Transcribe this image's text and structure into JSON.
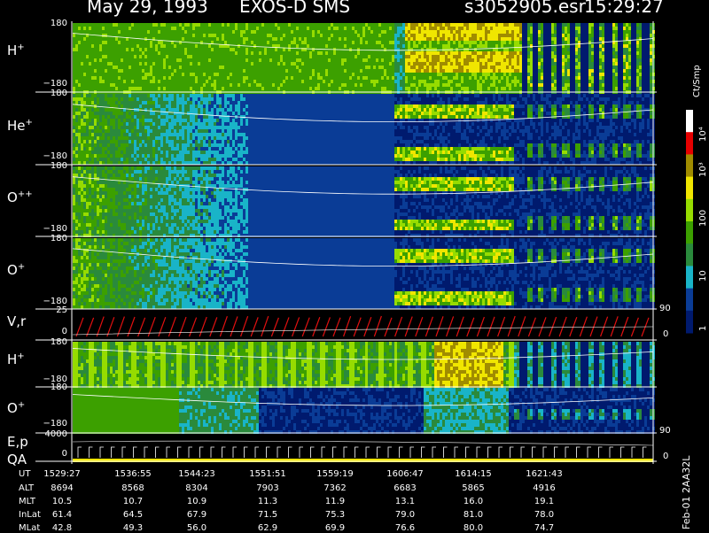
{
  "header": {
    "date": "May 29, 1993",
    "mission": "EXOS-D SMS",
    "file": "s3052905.esr",
    "time": "15:29:27"
  },
  "panels": [
    {
      "label": "H",
      "charge": "+",
      "top": "180",
      "bottom": "−180"
    },
    {
      "label": "He",
      "charge": "+",
      "top": "180",
      "bottom": "−180"
    },
    {
      "label": "O",
      "charge": "++",
      "top": "180",
      "bottom": "−180"
    },
    {
      "label": "O",
      "charge": "+",
      "top": "180",
      "bottom": "−180"
    },
    {
      "label": "V,r",
      "charge": "",
      "top": "25",
      "bottom": "0"
    },
    {
      "label": "H",
      "charge": "+",
      "top": "180",
      "bottom": "−180"
    },
    {
      "label": "O",
      "charge": "+",
      "top": "180",
      "bottom": "−180"
    },
    {
      "label": "E,p",
      "charge": "",
      "top": "4000",
      "bottom": "0"
    }
  ],
  "qa_label": "QA",
  "right_ticks": {
    "vr_top": "90",
    "vr_bottom": "0",
    "ep_top": "90",
    "ep_bottom": "0"
  },
  "colorbar": {
    "unit": "Ct/Smp",
    "labels": [
      "10⁴",
      "10³",
      "100",
      "10",
      "1"
    ]
  },
  "table": {
    "rows": [
      {
        "label": "UT",
        "values": [
          "1529:27",
          "1536:55",
          "1544:23",
          "1551:51",
          "1559:19",
          "1606:47",
          "1614:15",
          "1621:43"
        ]
      },
      {
        "label": "ALT",
        "values": [
          "8694",
          "8568",
          "8304",
          "7903",
          "7362",
          "6683",
          "5865",
          "4916"
        ]
      },
      {
        "label": "MLT",
        "values": [
          "10.5",
          "10.7",
          "10.9",
          "11.3",
          "11.9",
          "13.1",
          "16.0",
          "19.1"
        ]
      },
      {
        "label": "InLat",
        "values": [
          "61.4",
          "64.5",
          "67.9",
          "71.5",
          "75.3",
          "79.0",
          "81.0",
          "78.0"
        ]
      },
      {
        "label": "MLat",
        "values": [
          "42.8",
          "49.3",
          "56.0",
          "62.9",
          "69.9",
          "76.6",
          "80.0",
          "74.7"
        ]
      }
    ]
  },
  "footer_tag": "Feb-01 2AA32L",
  "chart_data": {
    "type": "heatmap",
    "title": "May 29, 1993   EXOS-D SMS",
    "x_ticks": [
      "1529:27",
      "1536:55",
      "1544:23",
      "1551:51",
      "1559:19",
      "1606:47",
      "1614:15",
      "1621:43"
    ],
    "panels": [
      {
        "name": "H+",
        "ylim": [
          -180,
          180
        ]
      },
      {
        "name": "He+",
        "ylim": [
          -180,
          180
        ]
      },
      {
        "name": "O++",
        "ylim": [
          -180,
          180
        ]
      },
      {
        "name": "O+",
        "ylim": [
          -180,
          180
        ]
      },
      {
        "name": "V,r",
        "ylim": [
          0,
          25
        ],
        "right_ylim": [
          0,
          90
        ]
      },
      {
        "name": "H+",
        "ylim": [
          -180,
          180
        ]
      },
      {
        "name": "O+",
        "ylim": [
          -180,
          180
        ]
      },
      {
        "name": "E,p",
        "ylim": [
          0,
          4000
        ],
        "right_ylim": [
          0,
          90
        ]
      }
    ],
    "colorbar": {
      "label": "Ct/Smp",
      "scale": "log",
      "range": [
        1,
        10000
      ]
    },
    "colors": {
      "background": "#001a6e",
      "low": "#0a3c96",
      "cyan": "#19b4c8",
      "green": "#3ca000",
      "lime": "#96dc00",
      "yellow": "#f0e600",
      "olive": "#a08c00",
      "red": "#e60000",
      "white": "#ffffff"
    }
  }
}
